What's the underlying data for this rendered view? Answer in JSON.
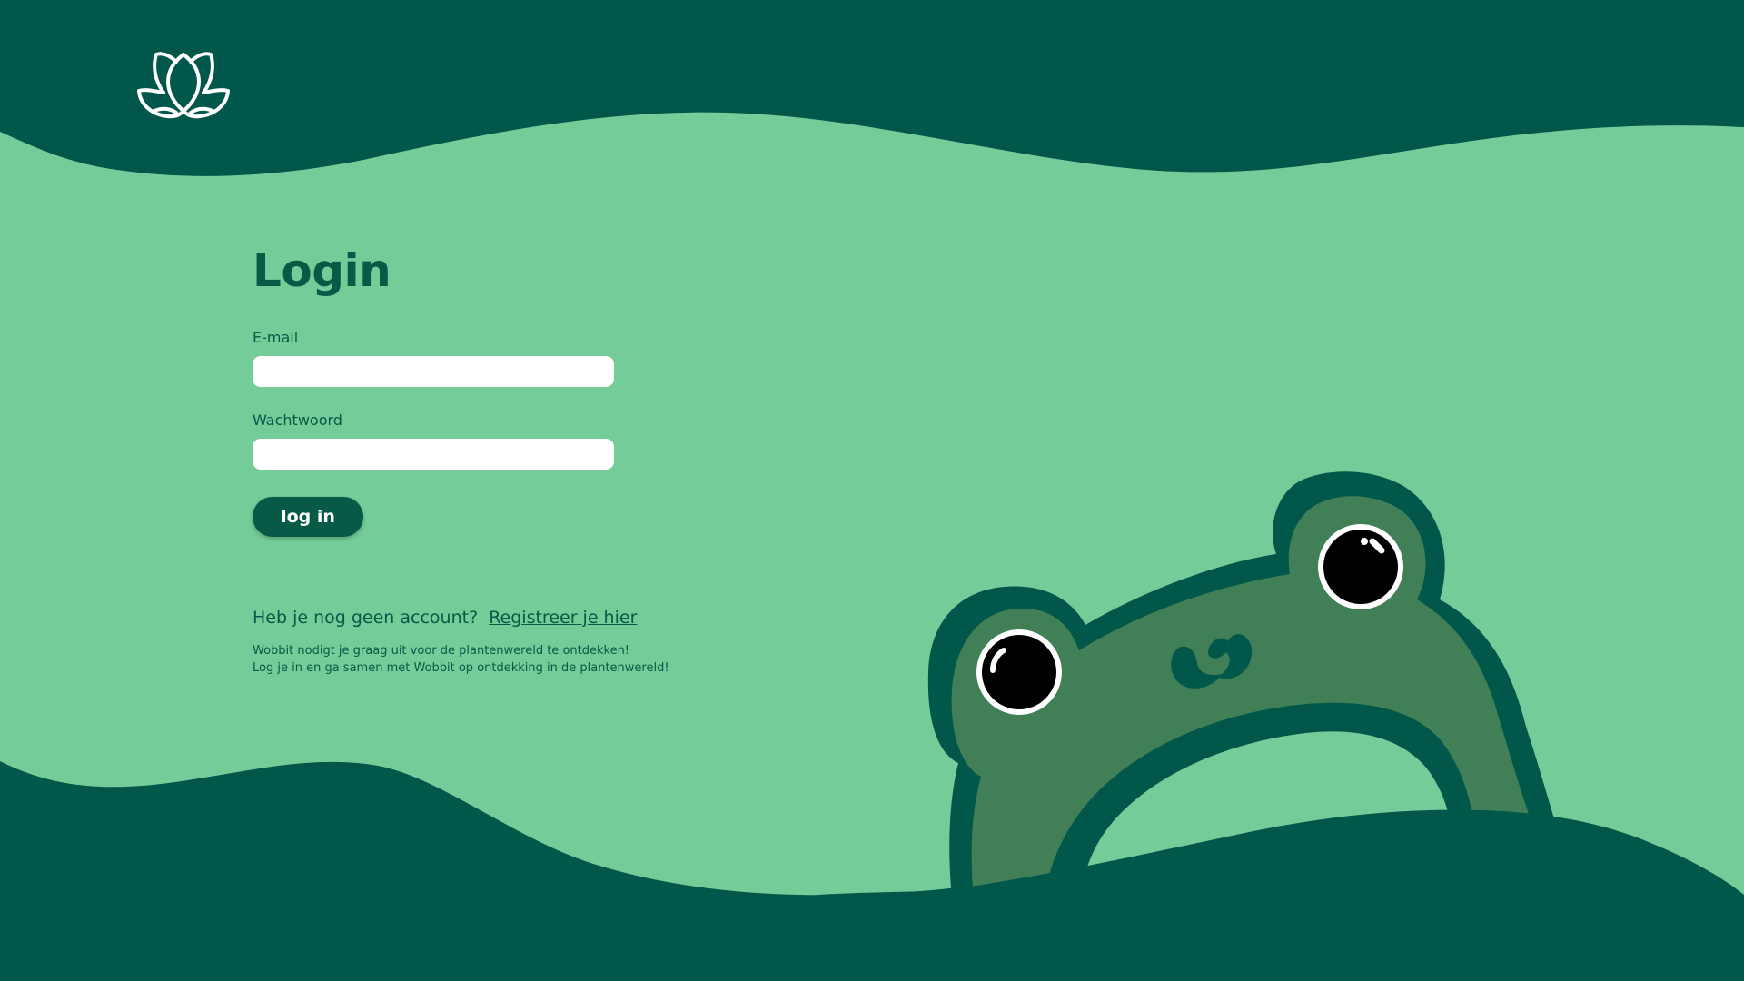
{
  "brand": {
    "logo_icon": "lotus-icon"
  },
  "login": {
    "title": "Login",
    "email_label": "E-mail",
    "email_value": "",
    "email_placeholder": "",
    "password_label": "Wachtwoord",
    "password_value": "",
    "password_placeholder": "",
    "submit_label": "log in"
  },
  "register": {
    "prompt": "Heb je nog geen account?",
    "link_label": "Registreer je hier"
  },
  "intro": {
    "line1": "Wobbit nodigt je graag uit voor de plantenwereld te ontdekken!",
    "line2": "Log je in en ga samen met Wobbit op ontdekking in de plantenwereld!"
  },
  "colors": {
    "dark_green": "#065a46",
    "light_green": "#74cc98",
    "frog_green": "#417f57",
    "white": "#ffffff"
  },
  "illustration": {
    "mascot_icon": "frog-icon"
  }
}
